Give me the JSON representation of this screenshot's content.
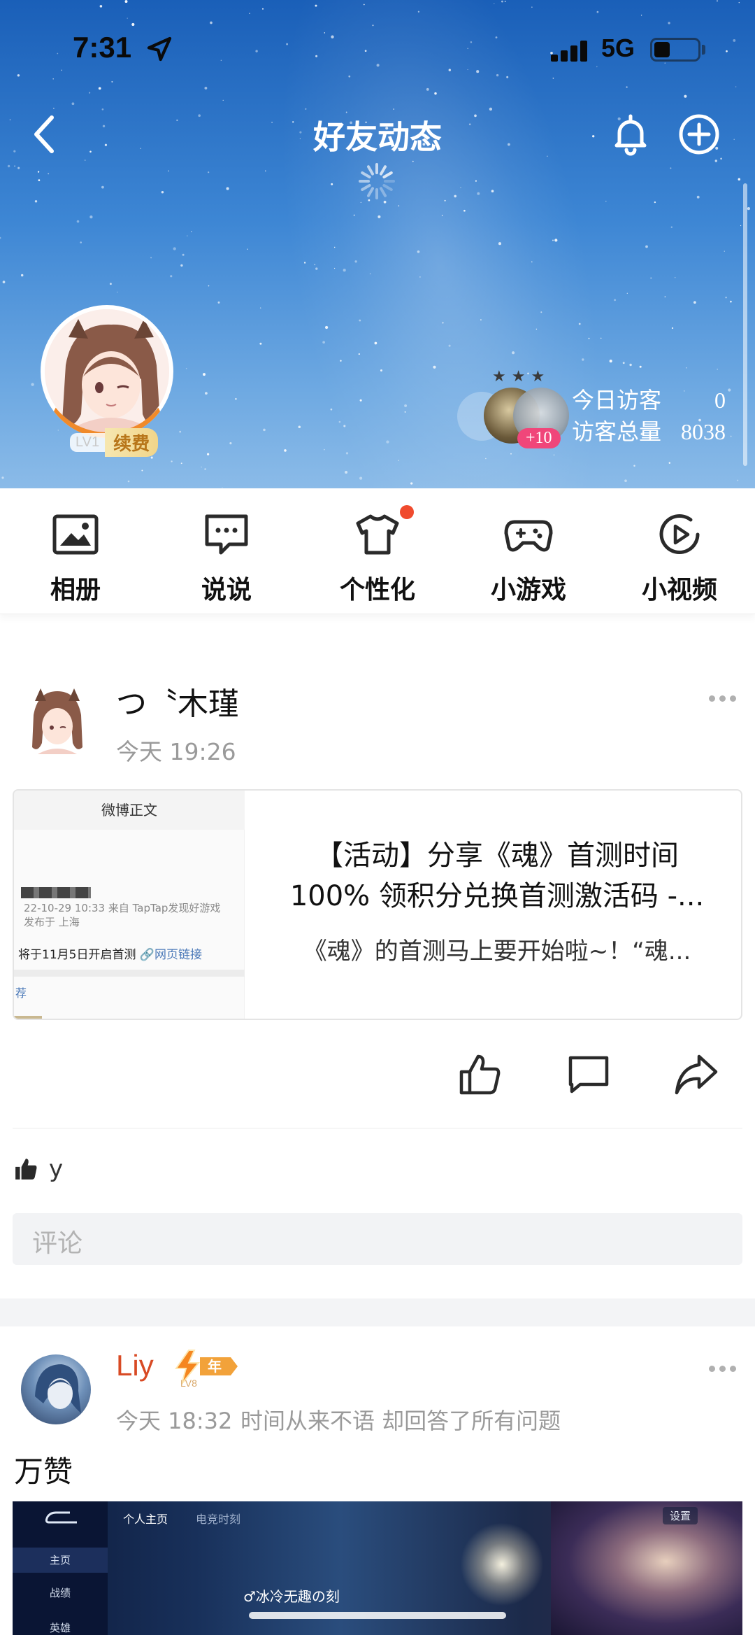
{
  "status_bar": {
    "time": "7:31",
    "network": "5G"
  },
  "header": {
    "title": "好友动态",
    "back_icon": "chevron-left-icon",
    "bell_icon": "bell-icon",
    "add_icon": "plus-circle-icon"
  },
  "profile": {
    "level": "LV1",
    "renew_label": "续费",
    "visitor_stars": "★★★",
    "visitor_count_badge": "+10",
    "today_visitors_label": "今日访客",
    "today_visitors_value": "0",
    "total_visitors_label": "访客总量",
    "total_visitors_value": "8038"
  },
  "quick_menu": [
    {
      "label": "相册",
      "icon": "album-icon"
    },
    {
      "label": "说说",
      "icon": "chat-bubble-icon"
    },
    {
      "label": "个性化",
      "icon": "tshirt-icon"
    },
    {
      "label": "小游戏",
      "icon": "gamepad-icon"
    },
    {
      "label": "小视频",
      "icon": "play-circle-icon"
    }
  ],
  "post1": {
    "author": "つ〝木瑾",
    "time": "今天 19:26",
    "share_card": {
      "thumb_header": "微博正文",
      "thumb_meta_line1": "22-10-29 10:33  来自 TapTap发现好游戏",
      "thumb_meta_line2": "发布于 上海",
      "thumb_text": "将于11月5日开启首测",
      "thumb_link": "🔗网页链接",
      "thumb_more": "荐",
      "title_line1": "【活动】分享《魂》首测时间",
      "title_line2": "100% 领积分兑换首测激活码 -...",
      "desc": "《魂》的首测马上要开始啦~！“魂..."
    },
    "like_names": "y",
    "comment_placeholder": "评论"
  },
  "post2": {
    "author": "Liy",
    "vip_level": "LV8",
    "vip_label": "年",
    "time": "今天 18:32",
    "signature": "时间从来不语 却回答了所有问题",
    "body": "万赞",
    "screenshot": {
      "side_home": "主页",
      "side_record": "战绩",
      "side_hero": "英雄",
      "tab_profile": "个人主页",
      "tab_second": "电竞时刻",
      "settings": "设置",
      "player_title": "♂冰冷无趣の刻"
    }
  },
  "colors": {
    "accent_orange": "#f08a2a",
    "badge_pink": "#f0467a",
    "vip_name_red": "#d84a24",
    "notification_dot": "#f04b2e"
  }
}
